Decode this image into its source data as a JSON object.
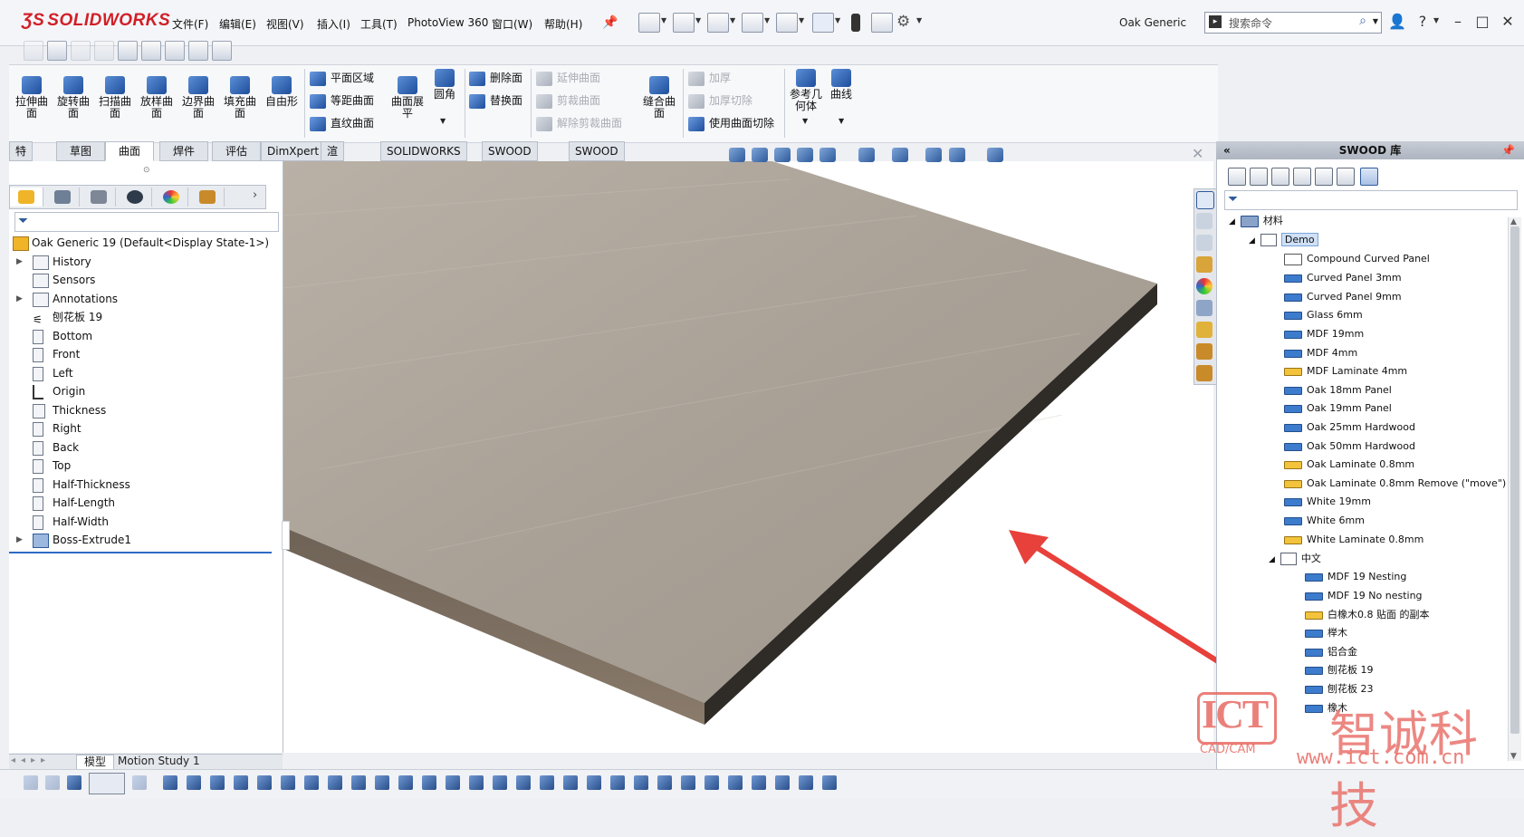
{
  "app": {
    "logo_ds": "ƷS",
    "logo_name": "SOLIDWORKS",
    "document_title": "Oak Generic"
  },
  "menu": [
    "文件(F)",
    "编辑(E)",
    "视图(V)",
    "插入(I)",
    "工具(T)",
    "PhotoView 360",
    "窗口(W)",
    "帮助(H)"
  ],
  "search": {
    "placeholder": "搜索命令"
  },
  "command_manager": {
    "big_buttons": [
      {
        "label": "拉伸曲面"
      },
      {
        "label": "旋转曲面"
      },
      {
        "label": "扫描曲面"
      },
      {
        "label": "放样曲面"
      },
      {
        "label": "边界曲面"
      },
      {
        "label": "填充曲面"
      },
      {
        "label": "自由形"
      }
    ],
    "col_planar": [
      "平面区域",
      "等距曲面",
      "直纹曲面"
    ],
    "flatten": "曲面展平",
    "fillet": "圆角",
    "col_delete": [
      "删除面",
      "替换面"
    ],
    "col_extend": [
      "延伸曲面",
      "剪裁曲面",
      "解除剪裁曲面"
    ],
    "knit": "缝合曲面",
    "col_thicken": [
      "加厚",
      "加厚切除",
      "使用曲面切除"
    ],
    "ref_geom": "参考几何体",
    "curves": "曲线"
  },
  "tabs": [
    "特征",
    "草图",
    "曲面",
    "焊件",
    "评估",
    "DimXpert",
    "渲染工具",
    "SOLIDWORKS 插件",
    "SWOOD Design",
    "SWOOD CAM"
  ],
  "feature_tree": {
    "root": "Oak Generic 19  (Default<Display State-1>)",
    "items": [
      "History",
      "Sensors",
      "Annotations",
      "刨花板 19",
      "Bottom",
      "Front",
      "Left",
      "Origin",
      "Thickness",
      "Right",
      "Back",
      "Top",
      "Half-Thickness",
      "Half-Length",
      "Half-Width",
      "Boss-Extrude1"
    ]
  },
  "bottom_tabs": [
    "模型",
    "Motion Study 1"
  ],
  "swood_panel": {
    "title": "SWOOD 库",
    "root": "材料",
    "folder_demo": "Demo",
    "demo_items": [
      {
        "label": "Compound Curved Panel",
        "kind": "compound"
      },
      {
        "label": "Curved Panel 3mm",
        "kind": "panel"
      },
      {
        "label": "Curved Panel 9mm",
        "kind": "panel"
      },
      {
        "label": "Glass 6mm",
        "kind": "panel"
      },
      {
        "label": "MDF 19mm",
        "kind": "panel"
      },
      {
        "label": "MDF 4mm",
        "kind": "panel"
      },
      {
        "label": "MDF Laminate 4mm",
        "kind": "laminate"
      },
      {
        "label": "Oak 18mm Panel",
        "kind": "panel"
      },
      {
        "label": "Oak 19mm Panel",
        "kind": "panel"
      },
      {
        "label": "Oak 25mm Hardwood",
        "kind": "panel"
      },
      {
        "label": "Oak 50mm Hardwood",
        "kind": "panel"
      },
      {
        "label": "Oak Laminate 0.8mm",
        "kind": "laminate"
      },
      {
        "label": "Oak Laminate 0.8mm Remove (\"move\")",
        "kind": "laminate"
      },
      {
        "label": "White 19mm",
        "kind": "panel"
      },
      {
        "label": "White 6mm",
        "kind": "panel"
      },
      {
        "label": "White Laminate 0.8mm",
        "kind": "laminate"
      }
    ],
    "folder_cn": "中文",
    "cn_items": [
      {
        "label": "MDF 19  Nesting",
        "kind": "panel"
      },
      {
        "label": "MDF 19 No nesting",
        "kind": "panel"
      },
      {
        "label": "白橡木0.8 贴面 的副本",
        "kind": "laminate"
      },
      {
        "label": "榉木",
        "kind": "panel"
      },
      {
        "label": "铝合金",
        "kind": "panel"
      },
      {
        "label": "刨花板 19",
        "kind": "panel"
      },
      {
        "label": "刨花板 23",
        "kind": "panel"
      },
      {
        "label": "橡木",
        "kind": "panel"
      }
    ]
  },
  "watermark": {
    "brand": "ICT",
    "sub": "CAD/CAM",
    "cn": "智诚科技",
    "url": "www.ict.com.cn"
  },
  "colors": {
    "logo_red": "#d11f27",
    "arrow_red": "#e8403a",
    "selection": "#cfe0f7"
  }
}
